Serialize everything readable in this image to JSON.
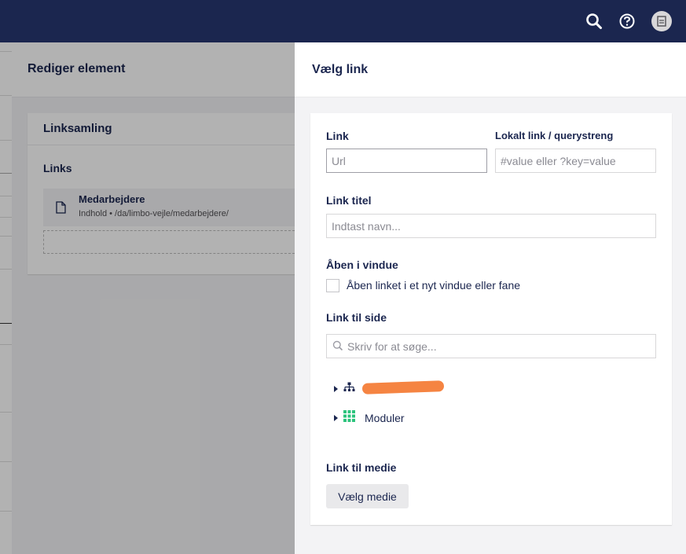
{
  "topbar": {
    "icons": [
      "search-icon",
      "help-icon",
      "user-avatar-icon"
    ],
    "background": "#1b264f"
  },
  "editor": {
    "title": "Rediger element",
    "card_title": "Linksamling",
    "links_label": "Links",
    "link_item": {
      "name": "Medarbejdere",
      "path": "Indhold • /da/limbo-vejle/medarbejdere/"
    }
  },
  "picker": {
    "title": "Vælg link",
    "link_label": "Link",
    "link_placeholder": "Url",
    "anchor_label": "Lokalt link / querystreng",
    "anchor_placeholder": "#value eller ?key=value",
    "title_label": "Link titel",
    "title_placeholder": "Indtast navn...",
    "target_label": "Åben i vindue",
    "target_checkbox_label": "Åben linket i et nyt vindue eller fane",
    "target_checked": false,
    "page_label": "Link til side",
    "search_placeholder": "Skriv for at søge...",
    "tree": [
      {
        "label": "",
        "icon": "sitemap-icon",
        "redacted": true
      },
      {
        "label": "Moduler",
        "icon": "grid-icon",
        "redacted": false
      }
    ],
    "media_label": "Link til medie",
    "media_button": "Vælg medie"
  },
  "colors": {
    "primary": "#1b264f",
    "redaction": "#f58442",
    "grid_icon": "#2bc37c"
  }
}
